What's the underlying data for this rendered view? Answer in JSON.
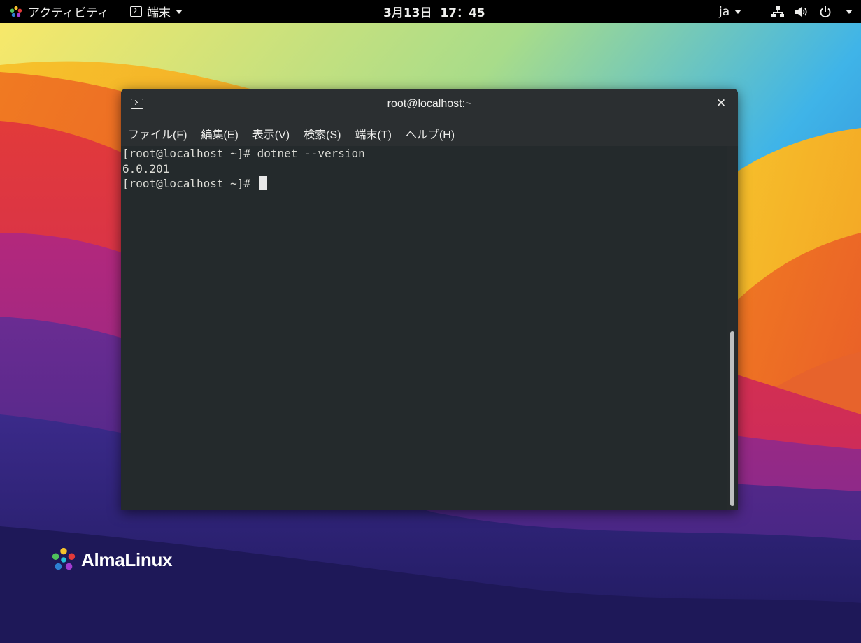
{
  "topbar": {
    "activities_label": "アクティビティ",
    "app_label": "端末",
    "clock": "3月13日  17：45",
    "language": "ja"
  },
  "window": {
    "title": "root@localhost:~",
    "close_glyph": "✕",
    "menu": [
      "ファイル(F)",
      "編集(E)",
      "表示(V)",
      "検索(S)",
      "端末(T)",
      "ヘルプ(H)"
    ]
  },
  "terminal": {
    "lines": [
      "[root@localhost ~]# dotnet --version",
      "6.0.201",
      "[root@localhost ~]# "
    ]
  },
  "desktop": {
    "brand": "AlmaLinux"
  },
  "colors": {
    "topbar_bg": "#000000",
    "terminal_bg": "#242a2c",
    "titlebar_bg": "#2b2f31",
    "text": "#eeeeec"
  },
  "icons": {
    "activities": "almalinux-logo-icon",
    "app": "terminal-icon",
    "network": "network-icon",
    "volume": "volume-icon",
    "power": "power-icon"
  }
}
